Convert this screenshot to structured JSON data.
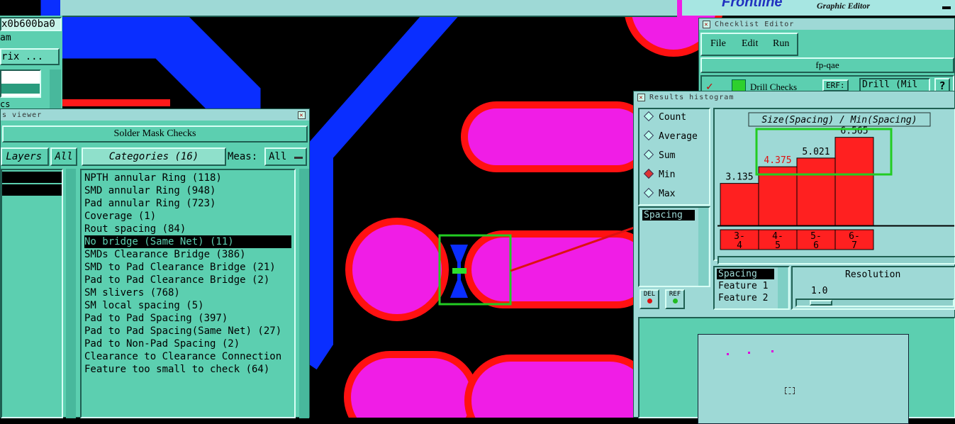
{
  "top_bar": {
    "brand_fragment": "Frontline",
    "brand_subtitle": "Graphic Editor"
  },
  "left_panel": {
    "address": "x0b600ba0",
    "label_am": "am",
    "button_matrix": "rix ...",
    "label_cs": "cs"
  },
  "viewer": {
    "title": "s viewer",
    "heading": "Solder Mask Checks",
    "layers_label": "Layers",
    "all_button": "All",
    "categories_label": "Categories (16)",
    "meas_label": "Meas:",
    "meas_value": "All",
    "categories": [
      "NPTH annular Ring (118)",
      "SMD annular Ring (948)",
      "Pad annular Ring (723)",
      "Coverage (1)",
      "Rout spacing (84)",
      "No bridge (Same Net) (11)",
      "SMDs Clearance Bridge (386)",
      "SMD to Pad Clearance Bridge (21)",
      "Pad to Pad Clearance Bridge (2)",
      "SM slivers (768)",
      "SM local spacing (5)",
      "Pad to Pad Spacing (397)",
      "Pad to Pad Spacing(Same Net) (27)",
      "Pad to Non-Pad Spacing (2)",
      "Clearance to Clearance Connection",
      "Feature too small to check (64)"
    ],
    "selected_index": 5
  },
  "checklist": {
    "title": "Checklist Editor",
    "menu": [
      "File",
      "Edit",
      "Run"
    ],
    "name": "fp-qae",
    "row_label": "Drill Checks",
    "row_badge": "ERF:",
    "row_field": "Drill (Mil"
  },
  "histogram": {
    "title": "Results histogram",
    "radios": [
      "Count",
      "Average",
      "Sum",
      "Min",
      "Max"
    ],
    "selected_radio": "Min",
    "list_selected": "Spacing",
    "del_label": "DEL",
    "ref_label": "REF",
    "features": [
      "Spacing",
      "Feature 1",
      "Feature 2"
    ],
    "resolution_label": "Resolution",
    "resolution_value": "1.0",
    "colors": {
      "bar": "#ff2020",
      "highlight_text": "#e01010"
    }
  },
  "chart_data": {
    "type": "bar",
    "title": "Size(Spacing) / Min(Spacing)",
    "categories": [
      "3-\n4",
      "4-\n5",
      "5-\n6",
      "6-\n7"
    ],
    "values": [
      3.135,
      4.375,
      5.021,
      6.565
    ],
    "value_labels": [
      "3.135",
      "4.375",
      "5.021",
      "6.565"
    ],
    "highlighted": [
      1
    ],
    "ylim": [
      0,
      7.5
    ]
  }
}
